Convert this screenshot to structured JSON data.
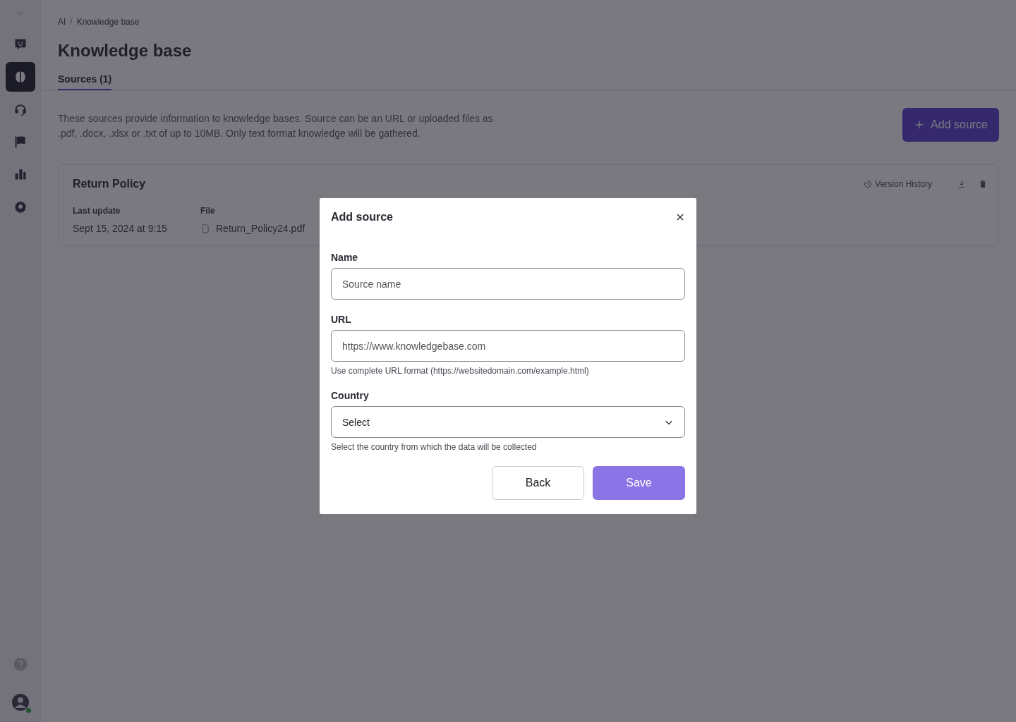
{
  "sidebar": {
    "items": [
      {
        "kind": "chat",
        "selected": false
      },
      {
        "kind": "brain",
        "selected": true
      },
      {
        "kind": "headset",
        "selected": false
      },
      {
        "kind": "flag",
        "selected": false
      },
      {
        "kind": "chart",
        "selected": false
      },
      {
        "kind": "gear",
        "selected": false
      }
    ],
    "user_online": true
  },
  "breadcrumb": {
    "items": [
      "AI",
      "Knowledge base"
    ],
    "separator": "/"
  },
  "title": "Knowledge base",
  "tabs": [
    {
      "label": "Sources (1)",
      "selected": true
    }
  ],
  "description": "These sources provide information to knowledge bases. Source can be an URL or uploaded files as .pdf, .docx, .xlsx or .txt of up to 10MB. Only text format knowledge will be gathered.",
  "add_button": "Add source",
  "sources": [
    {
      "name": "Return Policy",
      "last_update_label": "Last update",
      "last_update": "Sept 15, 2024 at 9:15",
      "file_label": "File",
      "file": "Return_Policy24.pdf",
      "version_history": "Version History"
    }
  ],
  "dialog": {
    "title": "Add source",
    "fields": [
      {
        "kind": "text",
        "label": "Name",
        "placeholder": "Source name"
      },
      {
        "kind": "text",
        "label": "URL",
        "placeholder": "https://www.knowledgebase.com",
        "hint": "Use complete URL format (https://websitedomain.com/example.html)"
      },
      {
        "kind": "select",
        "label": "Country",
        "value": "Select",
        "hint": "Select the country from which the data will be collected"
      }
    ],
    "back": "Back",
    "save": "Save",
    "save_disabled": true
  }
}
